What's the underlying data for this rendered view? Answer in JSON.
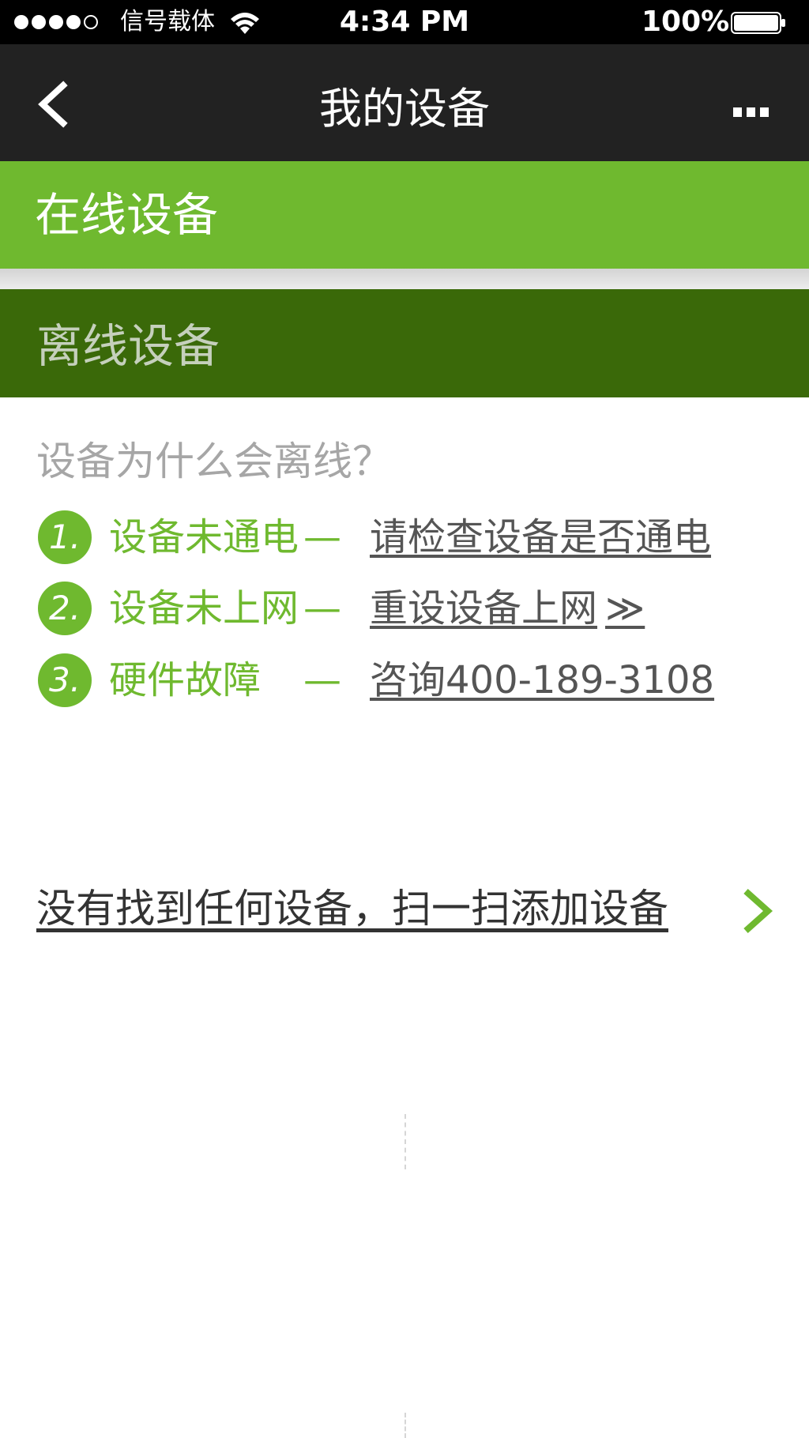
{
  "status_bar": {
    "carrier": "信号载体",
    "time": "4:34 PM",
    "battery": "100%"
  },
  "header": {
    "title": "我的设备"
  },
  "sections": {
    "online": "在线设备",
    "offline": "离线设备"
  },
  "help": {
    "question": "设备为什么会离线？",
    "reasons": [
      {
        "number": "1.",
        "label": "设备未通电",
        "dash": "—",
        "action": "请检查设备是否通电",
        "action_suffix": ""
      },
      {
        "number": "2.",
        "label": "设备未上网",
        "dash": "—",
        "action": "重设设备上网",
        "action_suffix": "≫"
      },
      {
        "number": "3.",
        "label": "硬件故障",
        "dash": "—",
        "action": "咨询400-189-3108",
        "action_suffix": ""
      }
    ]
  },
  "scan": {
    "label": "没有找到任何设备，扫一扫添加设备"
  },
  "colors": {
    "accent": "#6fb92f",
    "dark_green": "#3a6909",
    "title_bar": "#222222"
  }
}
